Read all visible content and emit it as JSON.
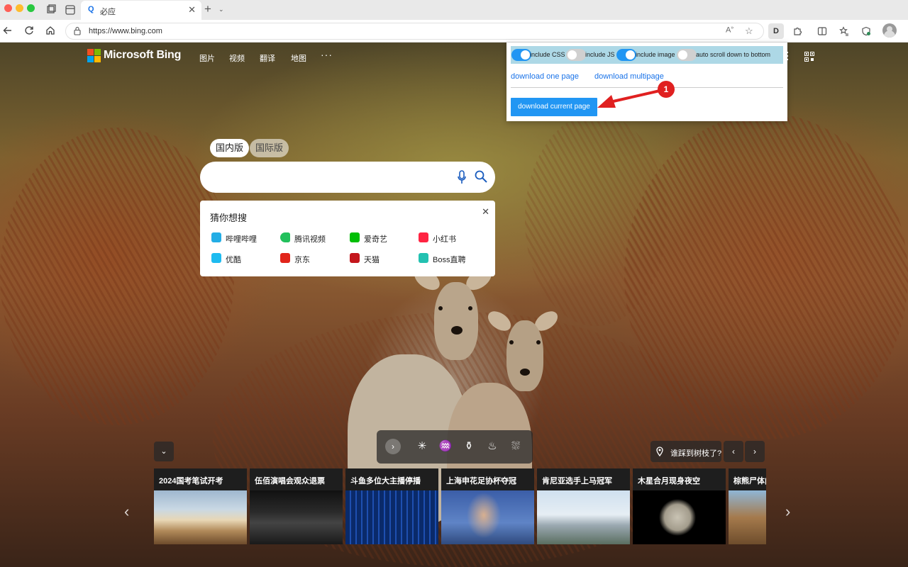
{
  "browser": {
    "tab_favicon": "Q",
    "tab_title": "必应",
    "tab_close": "✕",
    "new_tab": "+",
    "tab_list": "⌄",
    "url": "https://www.bing.com",
    "ext_d_label": "D"
  },
  "bing": {
    "logo_text": "Microsoft Bing",
    "nav": [
      "图片",
      "视频",
      "翻译",
      "地图"
    ],
    "nav_more": "···"
  },
  "search": {
    "pill_active": "国内版",
    "pill_inactive": "国际版",
    "suggest_title": "猜你想搜",
    "suggest_close": "✕",
    "items": [
      {
        "label": "哔哩哔哩",
        "color": "#23ade5"
      },
      {
        "label": "腾讯视频",
        "color": "#22c05c"
      },
      {
        "label": "爱奇艺",
        "color": "#00be06"
      },
      {
        "label": "小红书",
        "color": "#ff2442"
      },
      {
        "label": "优酷",
        "color": "#1ebbf0"
      },
      {
        "label": "京东",
        "color": "#e1251b"
      },
      {
        "label": "天猫",
        "color": "#c4161c"
      },
      {
        "label": "Boss直聘",
        "color": "#23c1b1"
      }
    ]
  },
  "extension": {
    "options": [
      {
        "label": "include CSS",
        "on": true
      },
      {
        "label": "include JS",
        "on": false
      },
      {
        "label": "include image",
        "on": true
      },
      {
        "label": "auto scroll down to bottom",
        "on": false
      }
    ],
    "tab_one": "download one page",
    "tab_multi": "download multipage",
    "button": "download current page",
    "callout_number": "1"
  },
  "bottom": {
    "collapse": "⌄",
    "tools": [
      "›",
      "✳",
      "♒",
      "⚱",
      "♨",
      "⛆"
    ],
    "location": "谁踩到树枝了?",
    "prev": "‹",
    "next": "›",
    "cards": [
      "2024国考笔试开考",
      "伍佰演唱会观众退票",
      "斗鱼多位大主播停播",
      "上海申花足协杯夺冠",
      "肯尼亚选手上马冠军",
      "木星合月现身夜空",
      "棕熊尸体内"
    ]
  }
}
